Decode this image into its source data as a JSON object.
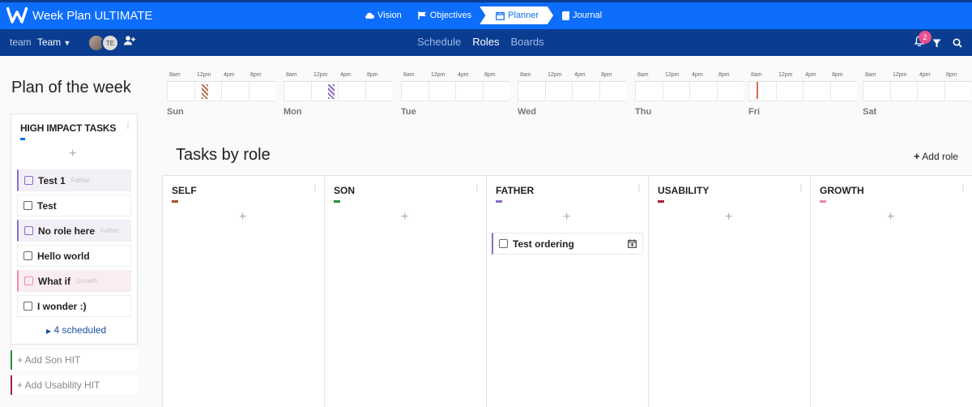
{
  "app": {
    "name": "Week Plan",
    "edition": "ULTIMATE"
  },
  "topnav": [
    {
      "label": "Vision",
      "icon": "cloud-icon"
    },
    {
      "label": "Objectives",
      "icon": "flag-icon"
    },
    {
      "label": "Planner",
      "icon": "calendar-icon",
      "active": true
    },
    {
      "label": "Journal",
      "icon": "book-icon"
    }
  ],
  "team": {
    "label": "team",
    "value": "Team"
  },
  "members": {
    "initials": "TE"
  },
  "views": [
    {
      "label": "Schedule"
    },
    {
      "label": "Roles",
      "active": true
    },
    {
      "label": "Boards"
    }
  ],
  "notifications": {
    "count": "2"
  },
  "plan": {
    "title": "Plan of the week",
    "hit_title": "HIGH IMPACT TASKS",
    "tasks": [
      {
        "label": "Test 1",
        "role": "Father"
      },
      {
        "label": "Test",
        "role": ""
      },
      {
        "label": "No role here",
        "role": "Father"
      },
      {
        "label": "Hello world",
        "role": ""
      },
      {
        "label": "What if",
        "role": "Growth"
      },
      {
        "label": "I wonder :)",
        "role": ""
      }
    ],
    "scheduled": "4 scheduled",
    "add_son": "+ Add Son HIT",
    "add_usability": "+ Add Usability HIT"
  },
  "week": {
    "ticks": [
      "8am",
      "12pm",
      "4pm",
      "8pm"
    ],
    "days": [
      "Sun",
      "Mon",
      "Tue",
      "Wed",
      "Thu",
      "Fri",
      "Sat"
    ]
  },
  "roles_section": {
    "title": "Tasks by role",
    "add_role": "Add role",
    "roles": [
      {
        "name": "SELF",
        "color": "#a0522d"
      },
      {
        "name": "SON",
        "color": "#2e8b3a"
      },
      {
        "name": "FATHER",
        "color": "#8b6cc9",
        "task": "Test ordering"
      },
      {
        "name": "USABILITY",
        "color": "#a0233d"
      },
      {
        "name": "GROWTH",
        "color": "#ef8ab0"
      }
    ]
  },
  "colors": {
    "primary": "#0d6efd",
    "navy": "#0a3d91",
    "badge": "#e8508f"
  }
}
